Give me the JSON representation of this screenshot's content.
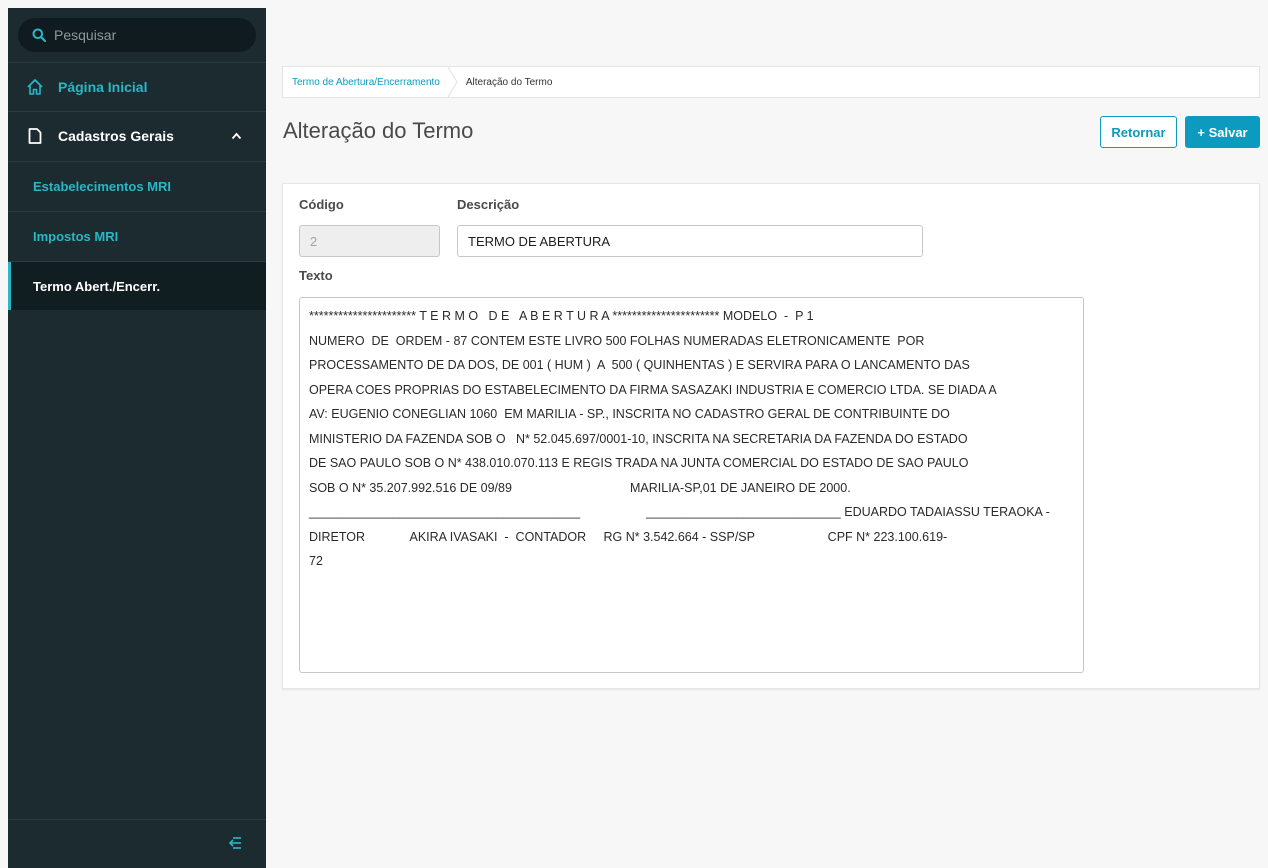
{
  "sidebar": {
    "search_placeholder": "Pesquisar",
    "items": [
      {
        "label": "Página Inicial",
        "icon": "home-icon"
      },
      {
        "label": "Cadastros Gerais",
        "icon": "document-icon",
        "expanded": true
      },
      {
        "label": "Estabelecimentos MRI"
      },
      {
        "label": "Impostos MRI"
      },
      {
        "label": "Termo Abert./Encerr.",
        "active": true
      }
    ],
    "collapse_icon": "collapse-menu-icon"
  },
  "breadcrumb": {
    "items": [
      "Termo de Abertura/Encerramento",
      "Alteração do Termo"
    ]
  },
  "page": {
    "title": "Alteração do Termo",
    "return_label": "Retornar",
    "save_label": "+ Salvar"
  },
  "form": {
    "codigo_label": "Código",
    "codigo_value": "2",
    "descricao_label": "Descrição",
    "descricao_value": "TERMO DE ABERTURA",
    "texto_label": "Texto",
    "texto_lines": [
      "********************** T E R M O   D E   A B E R T U R A ********************** MODELO  -  P 1",
      "NUMERO  DE  ORDEM - 87 CONTEM ESTE LIVRO 500 FOLHAS NUMERADAS ELETRONICAMENTE  POR",
      "PROCESSAMENTO DE DA DOS, DE 001 ( HUM )  A  500 ( QUINHENTAS ) E SERVIRA PARA O LANCAMENTO DAS",
      "OPERA COES PROPRIAS DO ESTABELECIMENTO DA FIRMA SASAZAKI INDUSTRIA E COMERCIO LTDA. SE DIADA A",
      "AV: EUGENIO CONEGLIAN 1060  EM MARILIA - SP., INSCRITA NO CADASTRO GERAL DE CONTRIBUINTE DO",
      "MINISTERIO DA FAZENDA SOB O   N* 52.045.697/0001-10, INSCRITA NA SECRETARIA DA FAZENDA DO ESTADO",
      "DE SAO PAULO SOB O N* 438.010.070.113 E REGIS TRADA NA JUNTA COMERCIAL DO ESTADO DE SAO PAULO",
      "SOB O N* 35.207.992.516 DE 09/89                                  MARILIA-SP,01 DE JANEIRO DE 2000.",
      "_______________________________________                   ____________________________ EDUARDO TADAIASSU TERAOKA -",
      "DIRETOR             AKIRA IVASAKI  -  CONTADOR     RG N* 3.542.664 - SSP/SP                     CPF N* 223.100.619-",
      "72"
    ]
  },
  "colors": {
    "sidebar_bg": "#1c2b30",
    "accent": "#0c9abe",
    "sidebar_accent": "#29b6c5"
  }
}
